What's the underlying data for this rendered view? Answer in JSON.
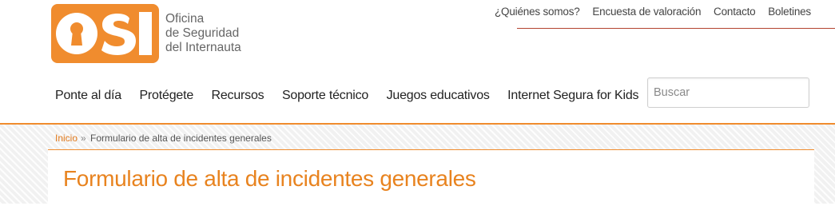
{
  "logo": {
    "mark": "OSI",
    "line1": "Oficina",
    "line2": "de Seguridad",
    "line3": "del Internauta"
  },
  "top_links": [
    "¿Quiénes somos?",
    "Encuesta de valoración",
    "Contacto",
    "Boletines"
  ],
  "nav": [
    "Ponte al día",
    "Protégete",
    "Recursos",
    "Soporte técnico",
    "Juegos educativos",
    "Internet Segura for Kids"
  ],
  "search": {
    "placeholder": "Buscar",
    "value": ""
  },
  "breadcrumb": {
    "home": "Inicio",
    "separator": "»",
    "current": "Formulario de alta de incidentes generales"
  },
  "page": {
    "title": "Formulario de alta de incidentes generales"
  },
  "colors": {
    "brand_orange": "#f08c2e",
    "title_orange": "#e8831f",
    "top_rule": "#b3432f"
  }
}
